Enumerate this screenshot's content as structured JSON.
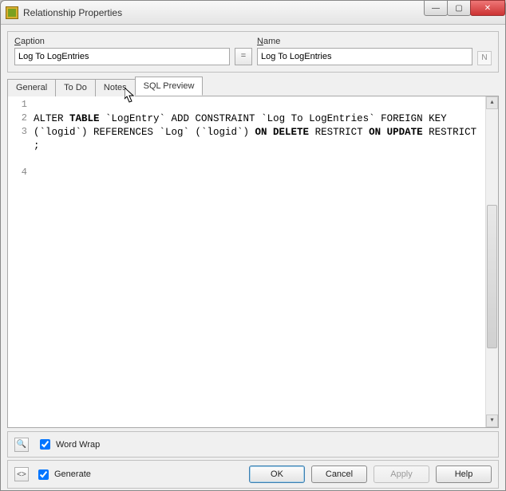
{
  "window": {
    "title": "Relationship Properties"
  },
  "header": {
    "caption_label": "Caption",
    "caption_value": "Log To LogEntries",
    "eq_label": "=",
    "name_label": "Name",
    "name_value": "Log To LogEntries",
    "name_icon": "N"
  },
  "tabs": {
    "general": "General",
    "todo": "To Do",
    "notes": "Notes",
    "sqlpreview": "SQL Preview",
    "active": "sqlpreview"
  },
  "editor": {
    "line_numbers": [
      "1",
      "2",
      "3",
      "4"
    ],
    "lines": [
      "",
      {
        "tokens": [
          {
            "t": "ALTER ",
            "b": false
          },
          {
            "t": "TABLE",
            "b": true
          },
          {
            "t": " `LogEntry` ADD CONSTRAINT `Log To LogEntries` FOREIGN KEY (`logid`) REFERENCES `Log` (`logid`) ",
            "b": false
          },
          {
            "t": "ON DELETE",
            "b": true
          },
          {
            "t": " RESTRICT ",
            "b": false
          },
          {
            "t": "ON UPDATE",
            "b": true
          },
          {
            "t": " RESTRICT",
            "b": false
          }
        ]
      },
      ";"
    ]
  },
  "lower": {
    "wordwrap_label": "Word Wrap",
    "wordwrap_checked": true,
    "generate_label": "Generate",
    "generate_checked": true
  },
  "buttons": {
    "ok": "OK",
    "cancel": "Cancel",
    "apply": "Apply",
    "help": "Help"
  }
}
